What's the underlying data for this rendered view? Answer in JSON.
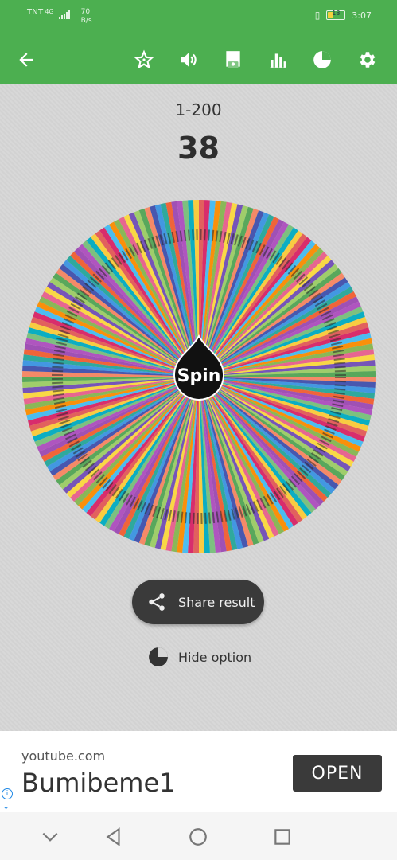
{
  "status_bar": {
    "carrier": "TNT",
    "network": "4G",
    "speed_value": "70",
    "speed_unit": "B/s",
    "battery": "18",
    "time": "3:07"
  },
  "app_bar": {
    "icons": [
      "back-arrow-icon",
      "star-icon",
      "volume-icon",
      "save-icon",
      "bar-chart-icon",
      "pie-chart-icon",
      "settings-icon"
    ]
  },
  "wheel": {
    "range_label": "1-200",
    "result": "38",
    "spin_label": "Spin",
    "segments": 200
  },
  "actions": {
    "share_label": "Share result",
    "hide_label": "Hide option"
  },
  "ad": {
    "url": "youtube.com",
    "title": "Bumibeme1",
    "open_label": "OPEN",
    "info": "i",
    "chevron": "⌄"
  },
  "colors": {
    "app_green": "#4caf50",
    "dark_button": "#3a3a3a",
    "background": "#d6d6d6"
  }
}
